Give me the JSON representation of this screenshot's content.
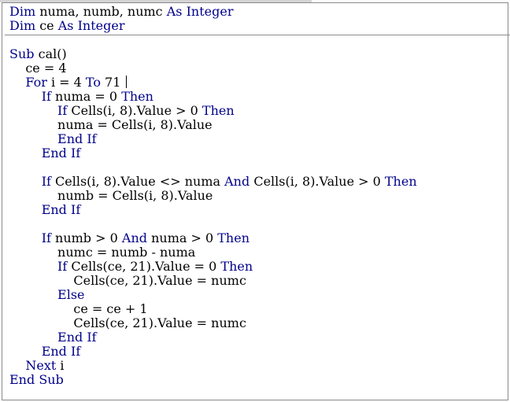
{
  "editor": {
    "lines": [
      [
        {
          "t": "Dim",
          "k": true
        },
        {
          "t": " numa, numb, numc "
        },
        {
          "t": "As",
          "k": true
        },
        {
          "t": " "
        },
        {
          "t": "Integer",
          "k": true
        }
      ],
      [
        {
          "t": "Dim",
          "k": true
        },
        {
          "t": " ce "
        },
        {
          "t": "As",
          "k": true
        },
        {
          "t": " "
        },
        {
          "t": "Integer",
          "k": true
        }
      ],
      [
        {
          "t": "Sub",
          "k": true
        },
        {
          "t": " cal()"
        }
      ],
      [
        {
          "t": "    ce = 4"
        }
      ],
      [
        {
          "t": "    "
        },
        {
          "t": "For",
          "k": true
        },
        {
          "t": " i = 4 "
        },
        {
          "t": "To",
          "k": true
        },
        {
          "t": " 71 "
        },
        {
          "caret": true
        }
      ],
      [
        {
          "t": "        "
        },
        {
          "t": "If",
          "k": true
        },
        {
          "t": " numa = 0 "
        },
        {
          "t": "Then",
          "k": true
        }
      ],
      [
        {
          "t": "            "
        },
        {
          "t": "If",
          "k": true
        },
        {
          "t": " Cells(i, 8).Value > 0 "
        },
        {
          "t": "Then",
          "k": true
        }
      ],
      [
        {
          "t": "            numa = Cells(i, 8).Value"
        }
      ],
      [
        {
          "t": "            "
        },
        {
          "t": "End",
          "k": true
        },
        {
          "t": " "
        },
        {
          "t": "If",
          "k": true
        }
      ],
      [
        {
          "t": "        "
        },
        {
          "t": "End",
          "k": true
        },
        {
          "t": " "
        },
        {
          "t": "If",
          "k": true
        }
      ],
      [
        {
          "t": "        "
        },
        {
          "t": "If",
          "k": true
        },
        {
          "t": " Cells(i, 8).Value <> numa "
        },
        {
          "t": "And",
          "k": true
        },
        {
          "t": " Cells(i, 8).Value > 0 "
        },
        {
          "t": "Then",
          "k": true
        }
      ],
      [
        {
          "t": "            numb = Cells(i, 8).Value"
        }
      ],
      [
        {
          "t": "        "
        },
        {
          "t": "End",
          "k": true
        },
        {
          "t": " "
        },
        {
          "t": "If",
          "k": true
        }
      ],
      [
        {
          "t": "        "
        },
        {
          "t": "If",
          "k": true
        },
        {
          "t": " numb > 0 "
        },
        {
          "t": "And",
          "k": true
        },
        {
          "t": " numa > 0 "
        },
        {
          "t": "Then",
          "k": true
        }
      ],
      [
        {
          "t": "            numc = numb - numa"
        }
      ],
      [
        {
          "t": "            "
        },
        {
          "t": "If",
          "k": true
        },
        {
          "t": " Cells(ce, 21).Value = 0 "
        },
        {
          "t": "Then",
          "k": true
        }
      ],
      [
        {
          "t": "                Cells(ce, 21).Value = numc"
        }
      ],
      [
        {
          "t": "            "
        },
        {
          "t": "Else",
          "k": true
        }
      ],
      [
        {
          "t": "                ce = ce + 1"
        }
      ],
      [
        {
          "t": "                Cells(ce, 21).Value = numc"
        }
      ],
      [
        {
          "t": "            "
        },
        {
          "t": "End",
          "k": true
        },
        {
          "t": " "
        },
        {
          "t": "If",
          "k": true
        }
      ],
      [
        {
          "t": "        "
        },
        {
          "t": "End",
          "k": true
        },
        {
          "t": " "
        },
        {
          "t": "If",
          "k": true
        }
      ],
      [
        {
          "t": "    "
        },
        {
          "t": "Next",
          "k": true
        },
        {
          "t": " i"
        }
      ],
      [
        {
          "t": "End",
          "k": true
        },
        {
          "t": " "
        },
        {
          "t": "Sub",
          "k": true
        }
      ]
    ]
  },
  "colors": {
    "keyword": "#00008b",
    "text": "#000000",
    "background": "#ffffff"
  }
}
